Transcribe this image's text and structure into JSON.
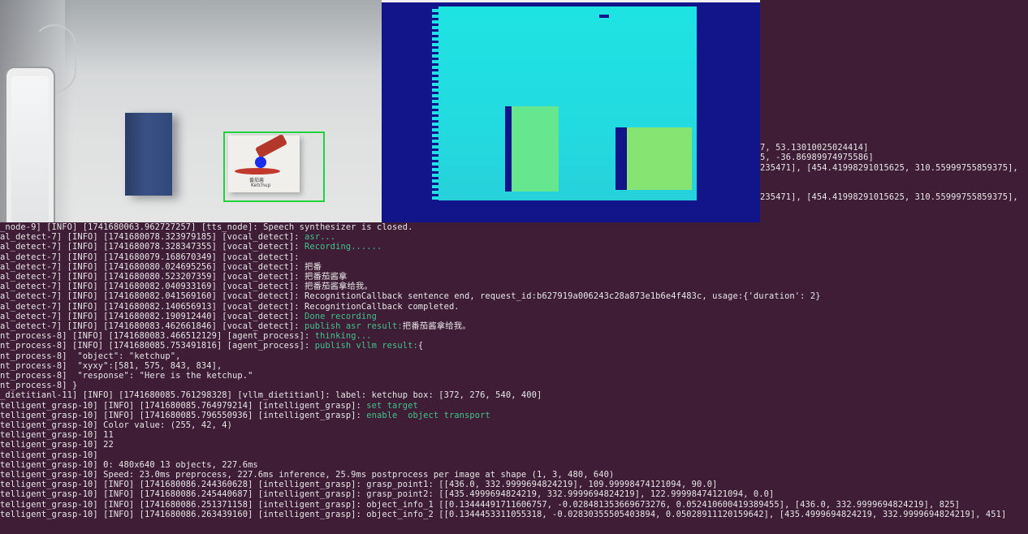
{
  "terminal": {
    "partial_right": [
      "7, 53.13010025024414]",
      "5, -36.86989974975586]",
      "235471], [454.41998291015625, 310.55999755859375],",
      "235471], [454.41998291015625, 310.55999755859375],"
    ],
    "log_lines": [
      [
        {
          "t": "_node-9] [INFO] [1741680063.962727257] [tts_node]: Speech synthesizer is closed."
        }
      ],
      [
        {
          "t": "al_detect-7] [INFO] [1741680078.323979185] [vocal_detect]: "
        },
        {
          "t": "asr...",
          "c": "hl"
        }
      ],
      [
        {
          "t": "al_detect-7] [INFO] [1741680078.328347355] [vocal_detect]: "
        },
        {
          "t": "Recording......",
          "c": "hl"
        }
      ],
      [
        {
          "t": "al_detect-7] [INFO] [1741680079.168670349] [vocal_detect]:"
        }
      ],
      [
        {
          "t": "al_detect-7] [INFO] [1741680080.024695256] [vocal_detect]: 把番"
        }
      ],
      [
        {
          "t": "al_detect-7] [INFO] [1741680080.523207359] [vocal_detect]: 把番茄酱拿"
        }
      ],
      [
        {
          "t": "al_detect-7] [INFO] [1741680082.040933169] [vocal_detect]: 把番茄酱拿给我。"
        }
      ],
      [
        {
          "t": "al_detect-7] [INFO] [1741680082.041569160] [vocal_detect]: RecognitionCallback sentence end, request_id:b627919a006243c28a873e1b6e4f483c, usage:{'duration': 2}"
        }
      ],
      [
        {
          "t": "al_detect-7] [INFO] [1741680082.140656913] [vocal_detect]: RecognitionCallback completed."
        }
      ],
      [
        {
          "t": "al_detect-7] [INFO] [1741680082.190912440] [vocal_detect]: "
        },
        {
          "t": "Done recording",
          "c": "hl"
        }
      ],
      [
        {
          "t": "al_detect-7] [INFO] [1741680083.462661846] [vocal_detect]: "
        },
        {
          "t": "publish asr result:",
          "c": "hl"
        },
        {
          "t": "把番茄酱拿给我。"
        }
      ],
      [
        {
          "t": "nt_process-8] [INFO] [1741680083.466512129] [agent_process]: "
        },
        {
          "t": "thinking...",
          "c": "hl"
        }
      ],
      [
        {
          "t": "nt_process-8] [INFO] [1741680085.753491816] [agent_process]: "
        },
        {
          "t": "publish vllm result:",
          "c": "hl"
        },
        {
          "t": "{"
        }
      ],
      [
        {
          "t": "nt_process-8]  \"object\": \"ketchup\","
        }
      ],
      [
        {
          "t": "nt_process-8]  \"xyxy\":[581, 575, 843, 834],"
        }
      ],
      [
        {
          "t": "nt_process-8]  \"response\": \"Here is the ketchup.\""
        }
      ],
      [
        {
          "t": "nt_process-8] }"
        }
      ],
      [
        {
          "t": "_dietitianl-11] [INFO] [1741680085.761298328] [vllm_dietitianl]: label: ketchup box: [372, 276, 540, 400]"
        }
      ],
      [
        {
          "t": "telligent_grasp-10] [INFO] [1741680085.764979214] [intelligent_grasp]: "
        },
        {
          "t": "set target",
          "c": "hl"
        }
      ],
      [
        {
          "t": "telligent_grasp-10] [INFO] [1741680085.796550936] [intelligent_grasp]: "
        },
        {
          "t": "enable  object transport",
          "c": "hl"
        }
      ],
      [
        {
          "t": "telligent_grasp-10] Color value: (255, 42, 4)"
        }
      ],
      [
        {
          "t": "telligent_grasp-10] 11"
        }
      ],
      [
        {
          "t": "telligent_grasp-10] 22"
        }
      ],
      [
        {
          "t": "telligent_grasp-10]"
        }
      ],
      [
        {
          "t": "telligent_grasp-10] 0: 480x640 13 objects, 227.6ms"
        }
      ],
      [
        {
          "t": "telligent_grasp-10] Speed: 23.0ms preprocess, 227.6ms inference, 25.9ms postprocess per image at shape (1, 3, 480, 640)"
        }
      ],
      [
        {
          "t": "telligent_grasp-10] [INFO] [1741680086.244360628] [intelligent_grasp]: grasp_point1: [[436.0, 332.9999694824219], 109.99998474121094, 90.0]"
        }
      ],
      [
        {
          "t": "telligent_grasp-10] [INFO] [1741680086.245440687] [intelligent_grasp]: grasp_point2: [[435.4999694824219, 332.9999694824219], 122.99998474121094, 0.0]"
        }
      ],
      [
        {
          "t": "telligent_grasp-10] [INFO] [1741680086.251371158] [intelligent_grasp]: object_info_1 [[0.13444491711606757, -0.028481353669673276, 0.052410600419389455], [436.0, 332.9999694824219], 825]"
        }
      ],
      [
        {
          "t": "telligent_grasp-10] [INFO] [1741680086.263439160] [intelligent_grasp]: object_info_2 [[0.1344453311055318, -0.02830355505403894, 0.05028911120159642], [435.4999694824219, 332.9999694824219], 451]"
        }
      ]
    ]
  },
  "rgb_view": {
    "card_text_cn": "番茄酱",
    "card_text_en": "Ketchup"
  },
  "colors": {
    "terminal_bg": "#3f1d36",
    "terminal_text": "#e6e6e6",
    "terminal_highlight": "#40c28a",
    "detection_box": "#22d23c",
    "grasp_point": "#1a2cf0",
    "depth_background": "#12148a",
    "depth_surface": "#1ee3e3"
  }
}
